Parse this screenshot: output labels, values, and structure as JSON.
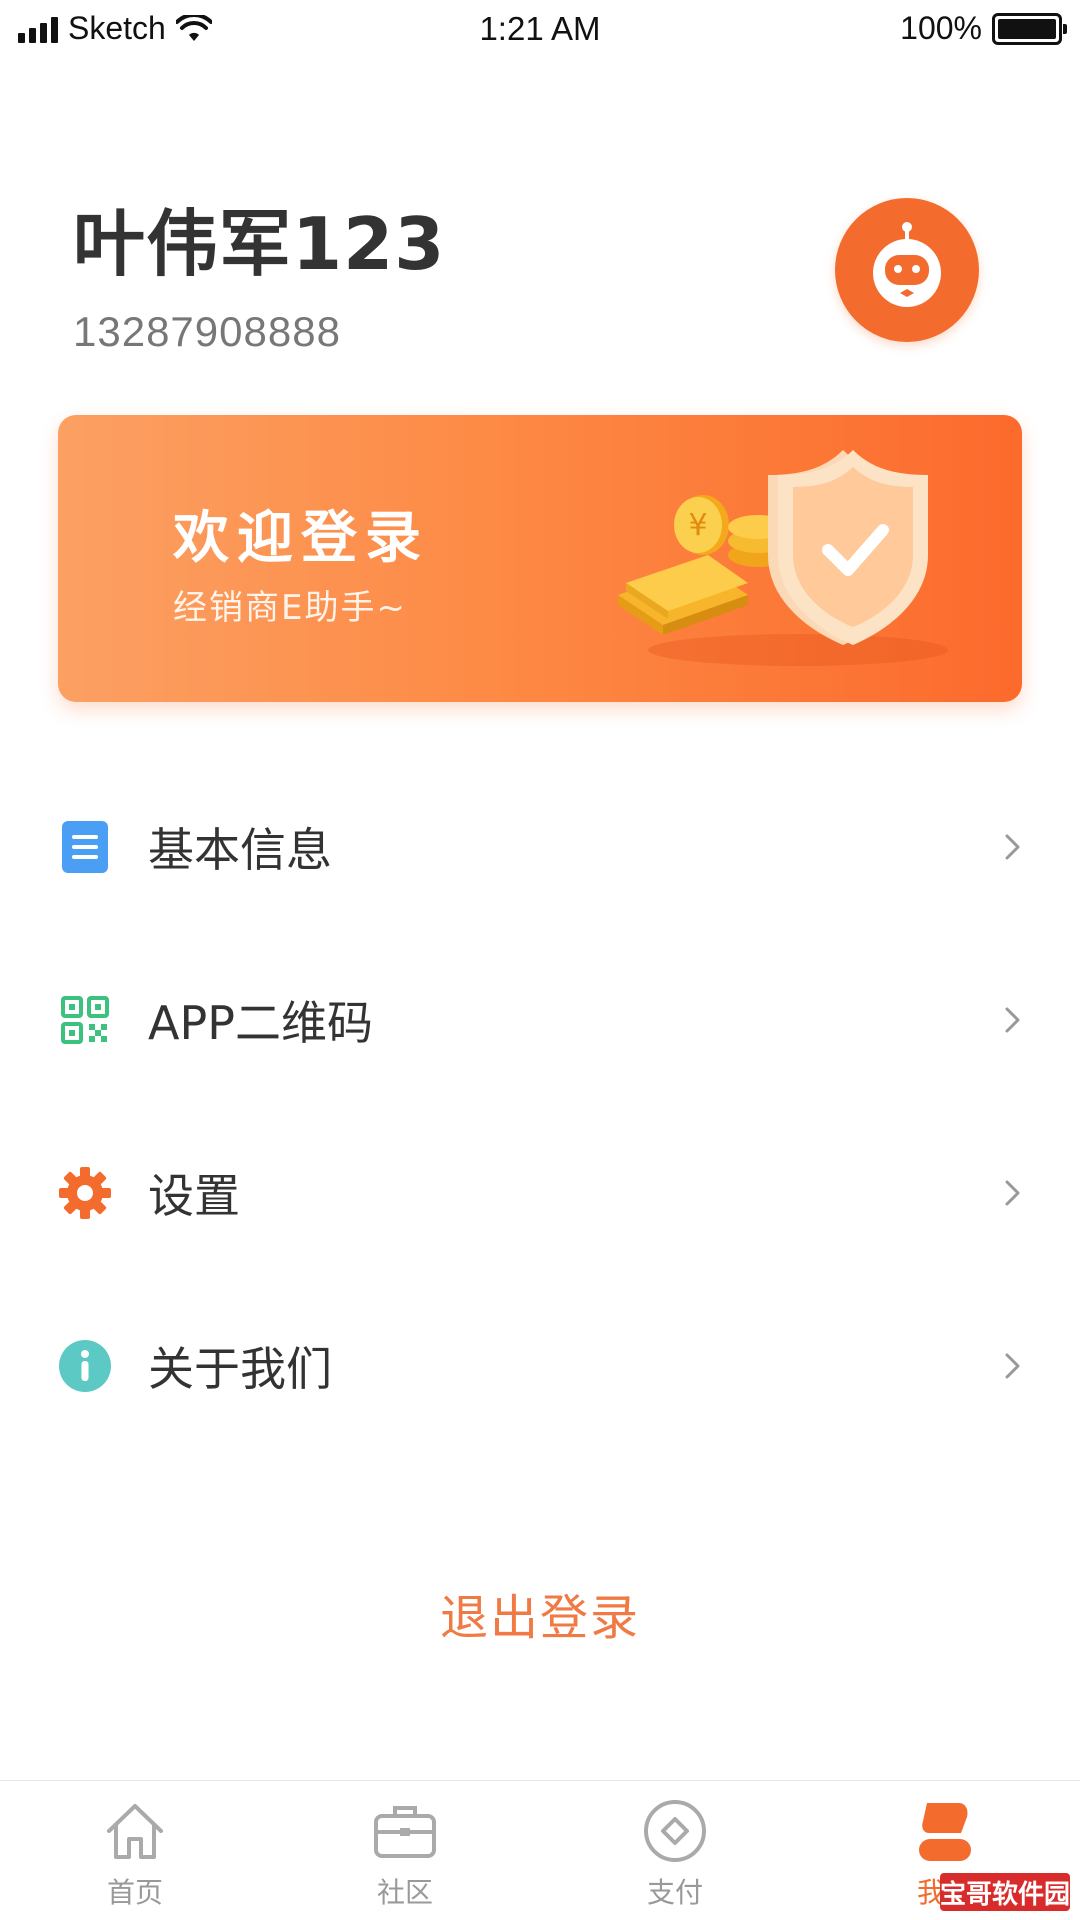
{
  "status_bar": {
    "carrier": "Sketch",
    "time": "1:21 AM",
    "battery": "100%"
  },
  "profile": {
    "name": "叶伟军123",
    "phone": "13287908888",
    "avatar_icon": "robot-avatar-icon"
  },
  "banner": {
    "title": "欢迎登录",
    "subtitle": "经销商E助手~"
  },
  "menu": {
    "items": [
      {
        "label": "基本信息",
        "icon": "document-icon",
        "color": "#4a9ff5"
      },
      {
        "label": "APP二维码",
        "icon": "qr-code-icon",
        "color": "#3cc17e"
      },
      {
        "label": "设置",
        "icon": "gear-icon",
        "color": "#f36c2d"
      },
      {
        "label": "关于我们",
        "icon": "info-icon",
        "color": "#5cc9c5"
      }
    ]
  },
  "logout_label": "退出登录",
  "tabbar": {
    "tabs": [
      {
        "label": "首页",
        "icon": "home-icon"
      },
      {
        "label": "社区",
        "icon": "briefcase-icon"
      },
      {
        "label": "支付",
        "icon": "payment-icon"
      },
      {
        "label": "我的",
        "icon": "user-icon",
        "active": true
      }
    ]
  },
  "watermark": "宝哥软件园",
  "colors": {
    "accent": "#f36c2d",
    "text": "#333333",
    "muted": "#999999"
  }
}
